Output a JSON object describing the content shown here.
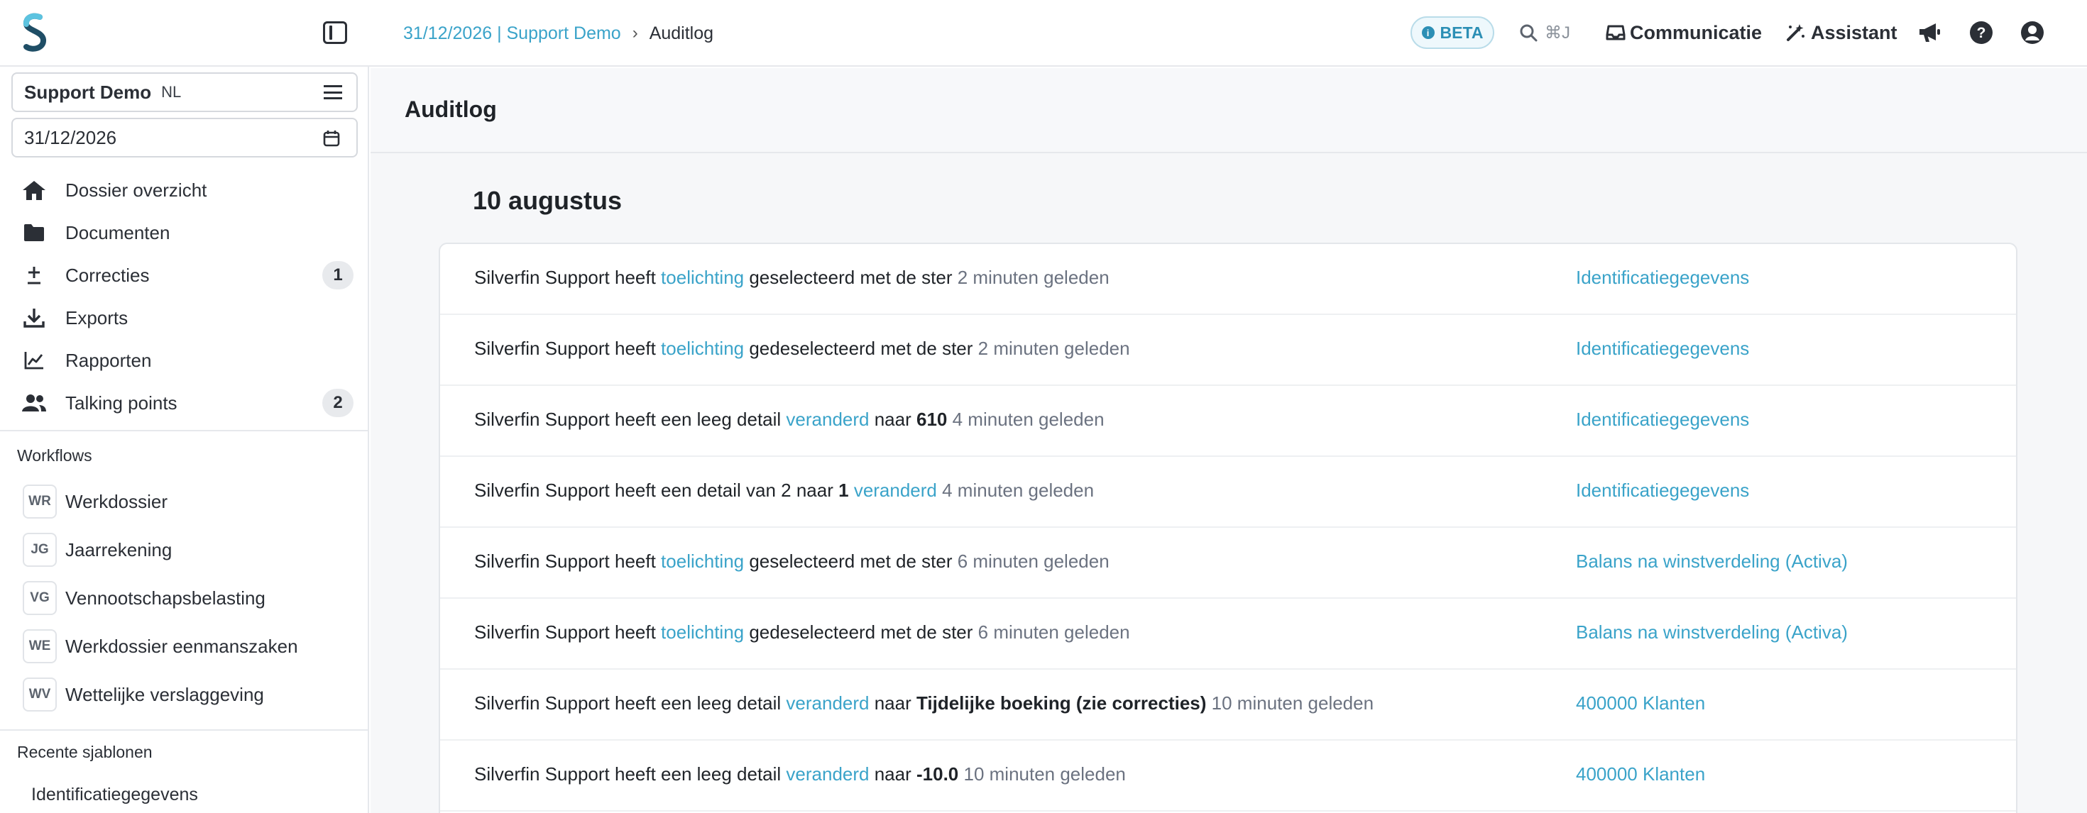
{
  "header": {
    "breadcrumb": {
      "link": "31/12/2026 | Support Demo",
      "separator": "›",
      "current": "Auditlog"
    },
    "beta_label": "BETA",
    "search_shortcut": "⌘J",
    "communicatie_label": "Communicatie",
    "assistant_label": "Assistant",
    "icons": [
      "sidebar-toggle-icon",
      "search-icon",
      "inbox-icon",
      "magic-wand-icon",
      "megaphone-icon",
      "help-icon",
      "user-icon"
    ]
  },
  "sidebar": {
    "company": {
      "name": "Support Demo",
      "lang": "NL"
    },
    "date": "31/12/2026",
    "nav": [
      {
        "label": "Dossier overzicht",
        "icon": "home-icon"
      },
      {
        "label": "Documenten",
        "icon": "folder-icon"
      },
      {
        "label": "Correcties",
        "icon": "plus-minus-icon",
        "count": "1"
      },
      {
        "label": "Exports",
        "icon": "download-icon"
      },
      {
        "label": "Rapporten",
        "icon": "line-chart-icon"
      },
      {
        "label": "Talking points",
        "icon": "users-icon",
        "count": "2"
      }
    ],
    "workflows_title": "Workflows",
    "workflows": [
      {
        "abbr": "WR",
        "label": "Werkdossier"
      },
      {
        "abbr": "JG",
        "label": "Jaarrekening"
      },
      {
        "abbr": "VG",
        "label": "Vennootschapsbelasting"
      },
      {
        "abbr": "WE",
        "label": "Werkdossier eenmanszaken"
      },
      {
        "abbr": "WV",
        "label": "Wettelijke verslaggeving"
      }
    ],
    "recent_title": "Recente sjablonen",
    "recent": [
      "Identificatiegegevens"
    ]
  },
  "main": {
    "title": "Auditlog",
    "date_heading": "10 augustus",
    "entries": [
      {
        "actor": "Silverfin Support heeft ",
        "link": "toelichting",
        "rest": " geselecteerd met de ster ",
        "strong": "",
        "after": "",
        "time": "2 minuten geleden",
        "target": "Identificatiegegevens"
      },
      {
        "actor": "Silverfin Support heeft ",
        "link": "toelichting",
        "rest": " gedeselecteerd met de ster ",
        "strong": "",
        "after": "",
        "time": "2 minuten geleden",
        "target": "Identificatiegegevens"
      },
      {
        "actor": "Silverfin Support heeft een leeg detail ",
        "link": "veranderd",
        "rest": " naar ",
        "strong": "610",
        "after": " ",
        "time": "4 minuten geleden",
        "target": "Identificatiegegevens"
      },
      {
        "actor": "Silverfin Support heeft een detail van 2 naar ",
        "strong_first": "1",
        "link": "veranderd",
        "time": "4 minuten geleden",
        "target": "Identificatiegegevens"
      },
      {
        "actor": "Silverfin Support heeft ",
        "link": "toelichting",
        "rest": " geselecteerd met de ster ",
        "strong": "",
        "after": "",
        "time": "6 minuten geleden",
        "target": "Balans na winstverdeling (Activa)"
      },
      {
        "actor": "Silverfin Support heeft ",
        "link": "toelichting",
        "rest": " gedeselecteerd met de ster ",
        "strong": "",
        "after": "",
        "time": "6 minuten geleden",
        "target": "Balans na winstverdeling (Activa)"
      },
      {
        "actor": "Silverfin Support heeft een leeg detail ",
        "link": "veranderd",
        "rest": " naar ",
        "strong": "Tijdelijke boeking (zie correcties)",
        "after": " ",
        "time": "10 minuten geleden",
        "target": "400000 Klanten"
      },
      {
        "actor": "Silverfin Support heeft een leeg detail ",
        "link": "veranderd",
        "rest": " naar ",
        "strong": "-10.0",
        "after": " ",
        "time": "10 minuten geleden",
        "target": "400000 Klanten"
      }
    ]
  },
  "colors": {
    "accent": "#3aa3c9",
    "text": "#1f2328",
    "muted": "#6b7280",
    "page_bg": "#f6f7f9"
  }
}
